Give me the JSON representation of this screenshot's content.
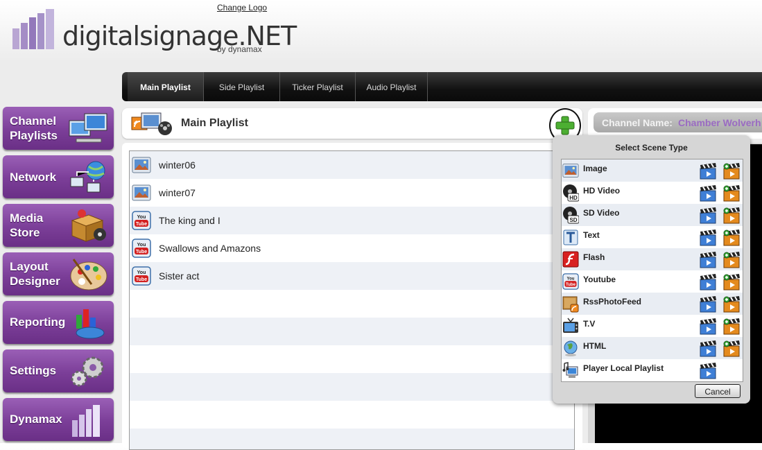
{
  "header": {
    "change_logo": "Change Logo",
    "logo_text": "digitalsignage.NET",
    "logo_sub": "by dynamax"
  },
  "tabs": [
    {
      "label": "Main Playlist",
      "active": true
    },
    {
      "label": "Side Playlist"
    },
    {
      "label": "Ticker Playlist"
    },
    {
      "label": "Audio Playlist"
    }
  ],
  "sidebar": {
    "items": [
      {
        "label": "Channel Playlists",
        "icon": "monitors-icon"
      },
      {
        "label": "Network",
        "icon": "network-icon"
      },
      {
        "label": "Media Store",
        "icon": "media-box-icon"
      },
      {
        "label": "Layout Designer",
        "icon": "palette-icon"
      },
      {
        "label": "Reporting",
        "icon": "chart-icon"
      },
      {
        "label": "Settings",
        "icon": "gears-icon"
      },
      {
        "label": "Dynamax",
        "icon": "dynamax-logo-icon"
      }
    ]
  },
  "playlist": {
    "title": "Main Playlist",
    "items": [
      {
        "name": "winter06",
        "icon": "image-icon"
      },
      {
        "name": "winter07",
        "icon": "image-icon"
      },
      {
        "name": "The king and I",
        "icon": "youtube-icon"
      },
      {
        "name": "Swallows and Amazons",
        "icon": "youtube-icon"
      },
      {
        "name": "Sister act",
        "icon": "youtube-icon"
      }
    ]
  },
  "channel": {
    "label": "Channel Name:",
    "value": "Chamber Wolverh"
  },
  "popup": {
    "title": "Select Scene Type",
    "cancel": "Cancel",
    "scene_types": [
      {
        "name": "Image",
        "icon": "image-icon"
      },
      {
        "name": "HD Video",
        "icon": "hd-reel-icon"
      },
      {
        "name": "SD Video",
        "icon": "sd-reel-icon"
      },
      {
        "name": "Text",
        "icon": "text-icon"
      },
      {
        "name": "Flash",
        "icon": "flash-icon"
      },
      {
        "name": "Youtube",
        "icon": "youtube-icon"
      },
      {
        "name": "RssPhotoFeed",
        "icon": "rss-photo-icon"
      },
      {
        "name": "T.V",
        "icon": "tv-icon"
      },
      {
        "name": "HTML",
        "icon": "globe-icon"
      },
      {
        "name": "Player Local Playlist",
        "icon": "local-playlist-icon"
      }
    ]
  },
  "colors": {
    "sidebar_purple": "#7b3e98",
    "channel_value": "#9a6bc2",
    "tab_bar": "#111111"
  }
}
